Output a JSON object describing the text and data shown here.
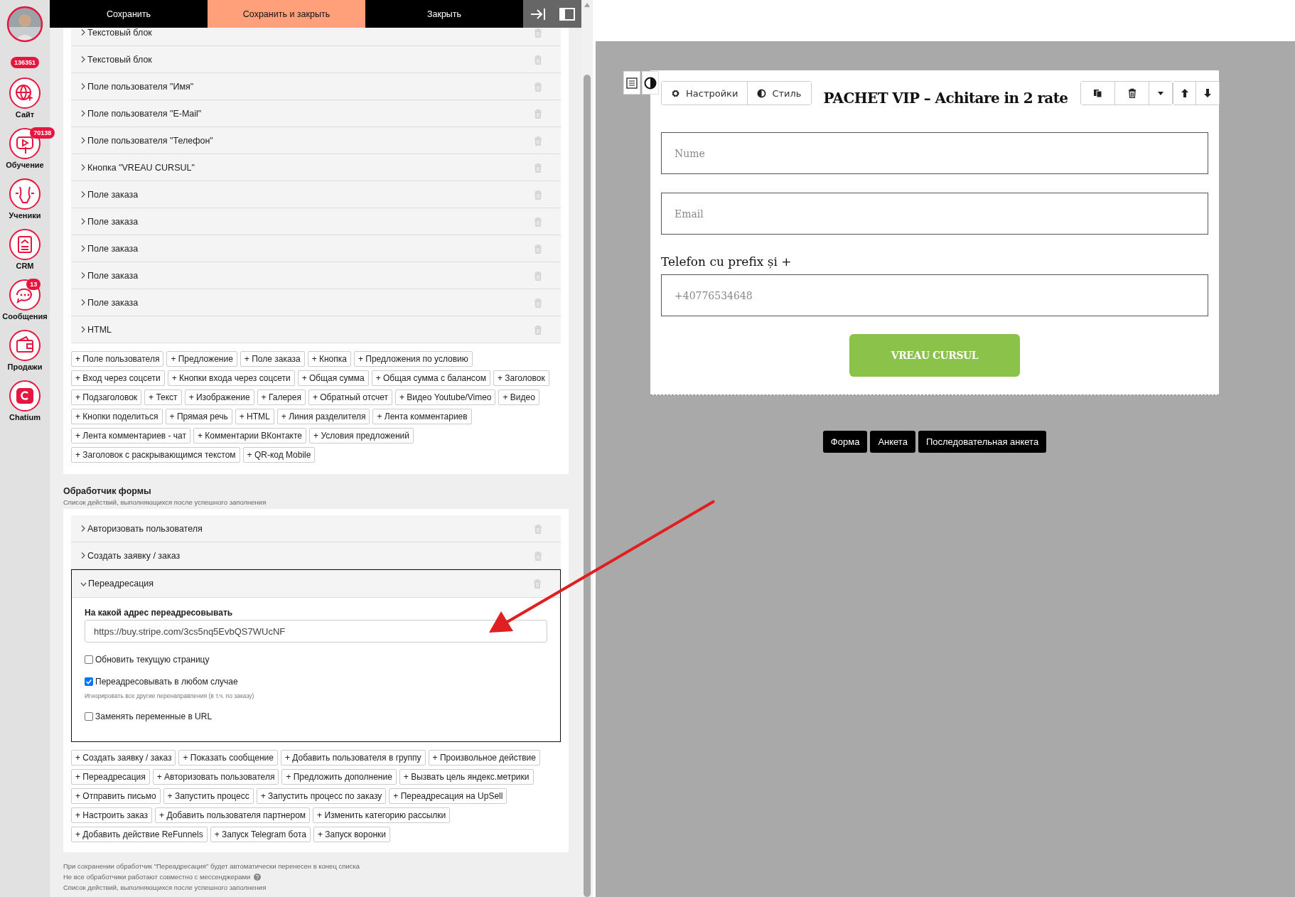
{
  "sidebar": {
    "balance_badge": "136351",
    "items": [
      {
        "label": "Сайт"
      },
      {
        "label": "Обучение",
        "badge": "70138"
      },
      {
        "label": "Ученики"
      },
      {
        "label": "CRM"
      },
      {
        "label": "Сообщения",
        "badge": "13"
      },
      {
        "label": "Продажи"
      },
      {
        "label": "Chatium"
      }
    ]
  },
  "toolbar": {
    "buttons": [
      {
        "label": "Сохранить",
        "primary": false
      },
      {
        "label": "Сохранить и закрыть",
        "primary": true
      },
      {
        "label": "Закрыть",
        "primary": false
      }
    ]
  },
  "blocks": {
    "items": [
      {
        "label": "Текстовый блок",
        "expanded": false
      },
      {
        "label": "Текстовый блок",
        "expanded": false
      },
      {
        "label": "Поле пользователя \"Имя\"",
        "expanded": false
      },
      {
        "label": "Поле пользователя \"E-Mail\"",
        "expanded": false
      },
      {
        "label": "Поле пользователя \"Телефон\"",
        "expanded": false
      },
      {
        "label": "Кнопка \"VREAU CURSUL\"",
        "expanded": false
      },
      {
        "label": "Поле заказа",
        "expanded": false
      },
      {
        "label": "Поле заказа",
        "expanded": false
      },
      {
        "label": "Поле заказа",
        "expanded": false
      },
      {
        "label": "Поле заказа",
        "expanded": false
      },
      {
        "label": "Поле заказа",
        "expanded": false
      },
      {
        "label": "HTML",
        "expanded": false
      }
    ],
    "add_buttons": [
      "+ Поле пользователя",
      "+ Предложение",
      "+ Поле заказа",
      "+ Кнопка",
      "+ Предложения по условию",
      "+ Вход через соцсети",
      "+ Кнопки входа через соцсети",
      "+ Общая сумма",
      "+ Общая сумма с балансом",
      "+ Заголовок",
      "+ Подзаголовок",
      "+ Текст",
      "+ Изображение",
      "+ Галерея",
      "+ Обратный отсчет",
      "+ Видео Youtube/Vimeo",
      "+ Видео",
      "+ Кнопки поделиться",
      "+ Прямая речь",
      "+ HTML",
      "+ Линия разделителя",
      "+ Лента комментариев",
      "+ Лента комментариев - чат",
      "+ Комментарии ВКонтакте",
      "+ Условия предложений",
      "+ Заголовок с раскрывающимся текстом",
      "+ QR-код Mobile"
    ]
  },
  "handler": {
    "title": "Обработчик формы",
    "subtitle": "Список действий, выполняющихся после успешного заполнения",
    "items": [
      {
        "label": "Авторизовать пользователя",
        "expanded": false
      },
      {
        "label": "Создать заявку / заказ",
        "expanded": false
      },
      {
        "label": "Переадресация",
        "expanded": true,
        "settings": {
          "field_label": "На какой адрес переадресовывать",
          "url": "https://buy.stripe.com/3cs5nq5EvbQS7WUcNF",
          "options": [
            {
              "label": "Обновить текущую страницу",
              "checked": false
            },
            {
              "label": "Переадресовывать в любом случае",
              "checked": true,
              "hint": "Игнорировать все другие перенаправления (в т.ч. по заказу)"
            },
            {
              "label": "Заменять переменные в URL",
              "checked": false
            }
          ]
        }
      }
    ],
    "add_buttons": [
      "+ Создать заявку / заказ",
      "+ Показать сообщение",
      "+ Добавить пользователя в группу",
      "+ Произвольное действие",
      "+ Переадресация",
      "+ Авторизовать пользователя",
      "+ Предложить дополнение",
      "+ Вызвать цель яндекс.метрики",
      "+ Отправить письмо",
      "+ Запустить процесс",
      "+ Запустить процесс по заказу",
      "+ Переадресация на UpSell",
      "+ Настроить заказ",
      "+ Добавить пользователя партнером",
      "+ Изменить категорию рассылки",
      "+ Добавить действие ReFunnels",
      "+ Запуск Telegram бота",
      "+ Запуск воронки"
    ],
    "notes": [
      {
        "text": "При сохранении обработчик \"Переадресация\" будет автоматически перенесен в конец списка",
        "help": false
      },
      {
        "text": "Не все обработчики работают совместно с мессенджерами",
        "help": true
      },
      {
        "text": "Список действий, выполняющихся после успешного заполнения",
        "help": false
      }
    ]
  },
  "preview": {
    "settings_button": "Настройки",
    "style_button": "Стиль",
    "title": "PACHET VIP – Achitare in 2 rate",
    "fields": [
      {
        "placeholder": "Nume"
      },
      {
        "placeholder": "Email"
      },
      {
        "label": "Telefon cu prefix și +",
        "placeholder": "+40776534648"
      }
    ],
    "submit": "VREAU CURSUL",
    "mode_buttons": [
      "Форма",
      "Анкета",
      "Последовательная анкета"
    ]
  }
}
